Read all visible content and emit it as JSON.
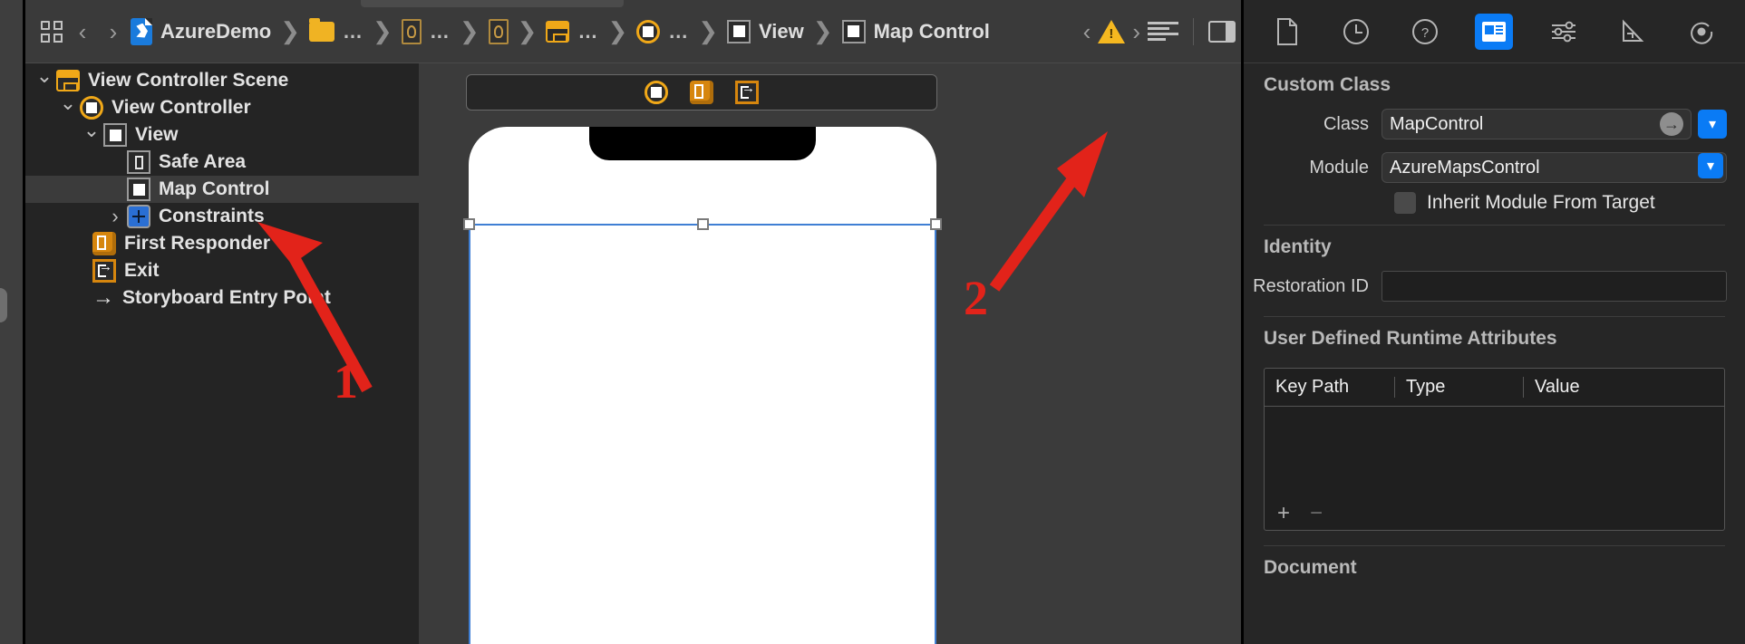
{
  "jumpbar": {
    "grid_icon": "grid-icon",
    "back_label": "‹",
    "forward_label": "›",
    "crumbs": [
      {
        "icon": "swift-file-icon",
        "label": "AzureDemo"
      },
      {
        "icon": "folder-icon",
        "label": "…"
      },
      {
        "icon": "storyboard-doc-icon",
        "label": "…"
      },
      {
        "icon": "scene-icon",
        "label": "…"
      },
      {
        "icon": "view-controller-icon",
        "label": "…"
      },
      {
        "icon": "view-icon",
        "label": "View"
      },
      {
        "icon": "view-icon",
        "label": "Map Control"
      }
    ],
    "issue_prev": "‹",
    "issue_icon": "warning-icon",
    "issue_next": "›",
    "align_icon": "text-lines-icon",
    "panel_icon": "panel-right-icon"
  },
  "outline": {
    "rows": [
      {
        "depth": 0,
        "disc": "open",
        "icon": "scene-icon",
        "label": "View Controller Scene",
        "selected": false
      },
      {
        "depth": 1,
        "disc": "open",
        "icon": "view-controller-icon",
        "label": "View Controller",
        "selected": false
      },
      {
        "depth": 2,
        "disc": "open",
        "icon": "view-icon",
        "label": "View",
        "selected": false
      },
      {
        "depth": 3,
        "disc": "none",
        "icon": "safe-area-icon",
        "label": "Safe Area",
        "selected": false
      },
      {
        "depth": 3,
        "disc": "none",
        "icon": "view-icon",
        "label": "Map Control",
        "selected": true
      },
      {
        "depth": 3,
        "disc": "closed",
        "icon": "constraints-icon",
        "label": "Constraints",
        "selected": false
      },
      {
        "depth": 2,
        "disc": "none",
        "icon": "first-responder-icon",
        "label": "First Responder",
        "selected": false
      },
      {
        "depth": 2,
        "disc": "none",
        "icon": "exit-icon",
        "label": "Exit",
        "selected": false
      },
      {
        "depth": 2,
        "disc": "none",
        "icon": "entry-point-arrow-icon",
        "label": "Storyboard Entry Point",
        "selected": false
      }
    ]
  },
  "canvas": {
    "dock_icons": [
      "view-controller-icon",
      "first-responder-icon",
      "exit-icon"
    ],
    "selection_color": "#3f7fd4"
  },
  "inspector": {
    "tabs": [
      {
        "name": "file-inspector-tab",
        "icon": "document-icon",
        "active": false
      },
      {
        "name": "history-inspector-tab",
        "icon": "clock-icon",
        "active": false
      },
      {
        "name": "help-inspector-tab",
        "icon": "question-icon",
        "active": false
      },
      {
        "name": "identity-inspector-tab",
        "icon": "identity-icon",
        "active": true
      },
      {
        "name": "attributes-inspector-tab",
        "icon": "sliders-icon",
        "active": false
      },
      {
        "name": "size-inspector-tab",
        "icon": "ruler-icon",
        "active": false
      },
      {
        "name": "connections-inspector-tab",
        "icon": "connections-icon",
        "active": false
      }
    ],
    "custom_class": {
      "title": "Custom Class",
      "class_label": "Class",
      "class_value": "MapControl",
      "module_label": "Module",
      "module_value": "AzureMapsControl",
      "inherit_label": "Inherit Module From Target",
      "inherit_checked": false
    },
    "identity": {
      "title": "Identity",
      "restoration_label": "Restoration ID",
      "restoration_value": "",
      "restoration_placeholder": ""
    },
    "runtime_attributes": {
      "title": "User Defined Runtime Attributes",
      "columns": [
        "Key Path",
        "Type",
        "Value"
      ],
      "rows": [],
      "add_label": "+",
      "remove_label": "−"
    },
    "document": {
      "title": "Document"
    }
  },
  "annotations": {
    "accent": "#e2231a",
    "items": [
      {
        "name": "callout-1",
        "number": "1"
      },
      {
        "name": "callout-2",
        "number": "2"
      }
    ]
  }
}
